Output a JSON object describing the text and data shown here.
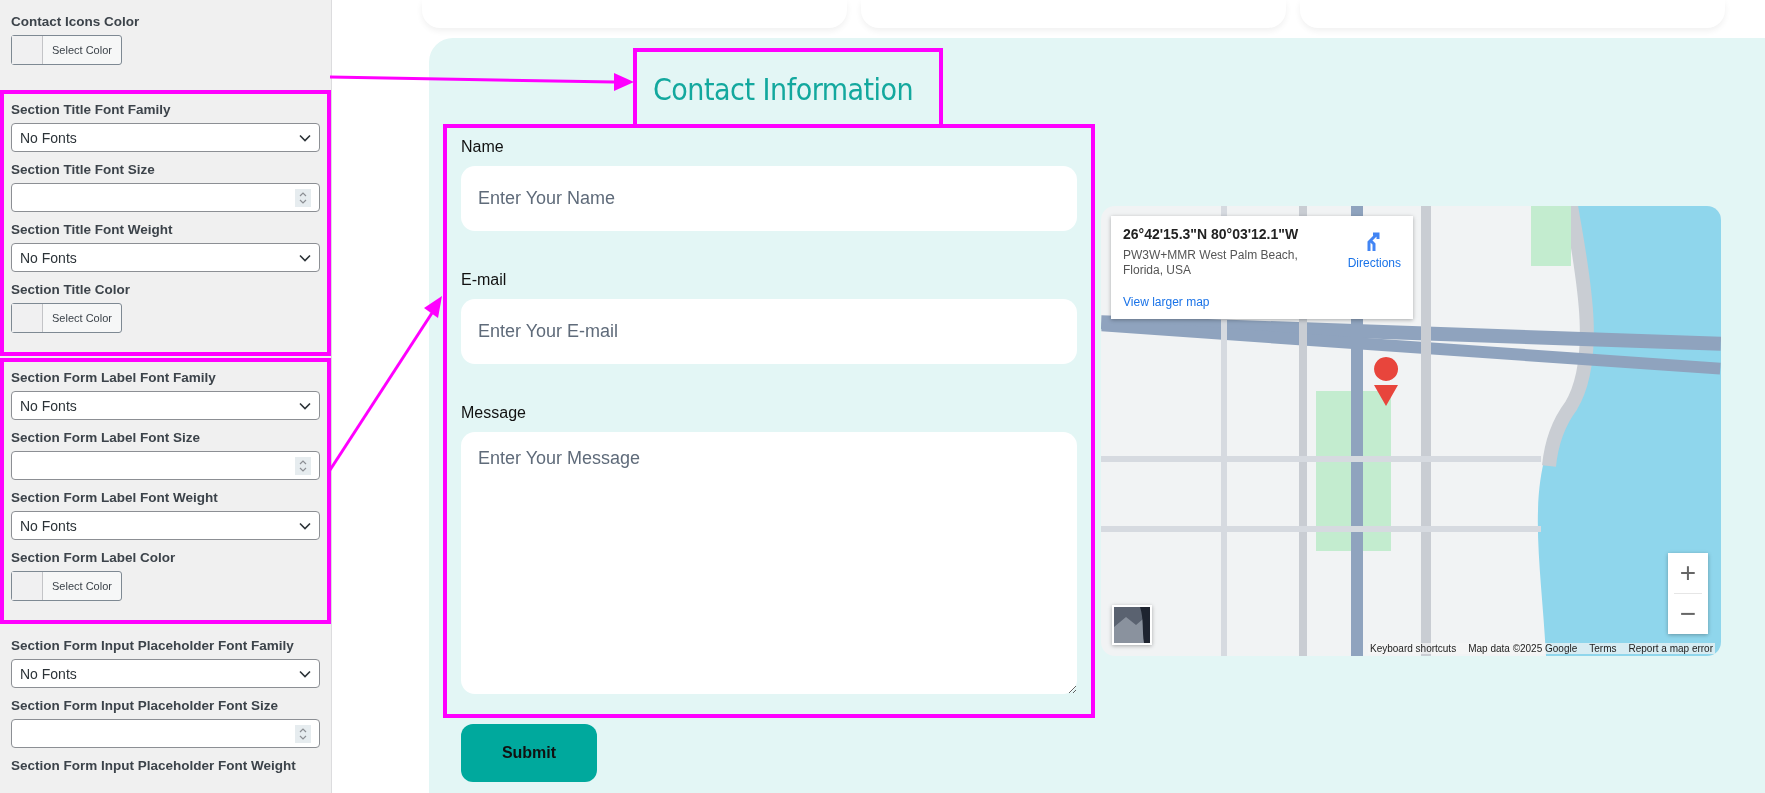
{
  "sidebar": {
    "sections": [
      {
        "highlighted": false,
        "controls": [
          {
            "kind": "color",
            "label": "Contact Icons Color",
            "button": "Select Color"
          }
        ]
      },
      {
        "highlighted": true,
        "controls": [
          {
            "kind": "select",
            "label": "Section Title Font Family",
            "value": "No Fonts"
          },
          {
            "kind": "number",
            "label": "Section Title Font Size"
          },
          {
            "kind": "select",
            "label": "Section Title Font Weight",
            "value": "No Fonts"
          },
          {
            "kind": "color",
            "label": "Section Title Color",
            "button": "Select Color"
          }
        ]
      },
      {
        "highlighted": true,
        "controls": [
          {
            "kind": "select",
            "label": "Section Form Label Font Family",
            "value": "No Fonts"
          },
          {
            "kind": "number",
            "label": "Section Form Label Font Size"
          },
          {
            "kind": "select",
            "label": "Section Form Label Font Weight",
            "value": "No Fonts"
          },
          {
            "kind": "color",
            "label": "Section Form Label Color",
            "button": "Select Color"
          }
        ]
      },
      {
        "highlighted": false,
        "controls": [
          {
            "kind": "select",
            "label": "Section Form Input Placeholder Font Family",
            "value": "No Fonts"
          },
          {
            "kind": "number",
            "label": "Section Form Input Placeholder Font Size"
          },
          {
            "kind": "label",
            "label": "Section Form Input Placeholder Font Weight"
          }
        ]
      }
    ]
  },
  "contact": {
    "title": "Contact Information",
    "title_highlighted": true,
    "form": {
      "highlighted": true,
      "fields": [
        {
          "kind": "input",
          "label": "Name",
          "placeholder": "Enter Your Name"
        },
        {
          "kind": "input",
          "label": "E-mail",
          "placeholder": "Enter Your E-mail"
        },
        {
          "kind": "textarea",
          "label": "Message",
          "placeholder": "Enter Your Message"
        }
      ]
    },
    "submit": "Submit",
    "map": {
      "kind": "picture",
      "info": {
        "coordinates": "26°42'15.3\"N 80°03'12.1\"W",
        "address": "PW3W+MMR West Palm Beach, Florida, USA",
        "directions": "Directions",
        "larger_map": "View larger map"
      },
      "zoom_in": "+",
      "zoom_out": "−",
      "footer": [
        "Keyboard shortcuts",
        "Map data ©2025 Google",
        "Terms",
        "Report a map error"
      ]
    }
  }
}
